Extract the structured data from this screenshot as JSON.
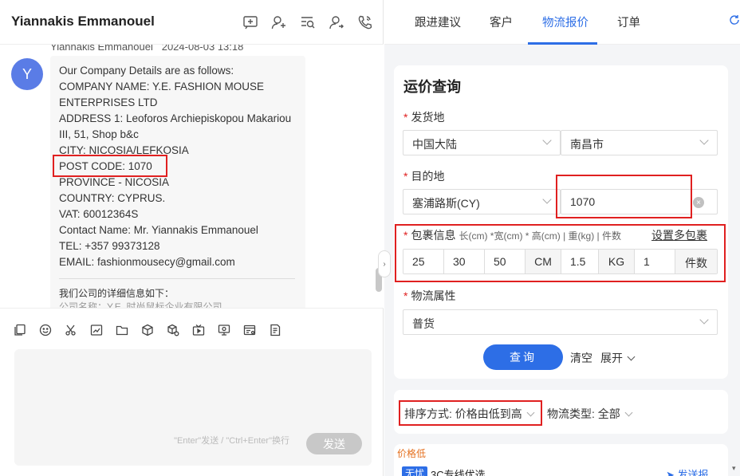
{
  "chat": {
    "contact_name": "Yiannakis Emmanouel",
    "meta_sender": "Yiannakis Emmanouel",
    "meta_time": "2024-08-03 13:18",
    "avatar_letter": "Y",
    "message_lines": [
      "Our Company Details are as follows:",
      "COMPANY NAME: Y.E. FASHION MOUSE",
      "ENTERPRISES LTD",
      "ADDRESS 1: Leoforos Archiepiskopou Makariou",
      "III, 51, Shop b&c",
      "CITY: NICOSIA/LEFKOSIA",
      "POST CODE: 1070",
      "PROVINCE - NICOSIA",
      "COUNTRY: CYPRUS.",
      "VAT: 60012364S",
      "Contact Name: Mr. Yiannakis Emmanouel",
      "TEL: +357 99373128",
      "EMAIL: fashionmousecy@gmail.com"
    ],
    "message_cn_line1": "我们公司的详细信息如下：",
    "message_cn_line2": "公司名称：Y.E. 时尚鼠标企业有限公司",
    "send_hint": "\"Enter\"发送 / \"Ctrl+Enter\"换行",
    "send_label": "发送"
  },
  "tabs": {
    "items": [
      "跟进建议",
      "客户",
      "物流报价",
      "订单"
    ],
    "active": "物流报价"
  },
  "form": {
    "title": "运价查询",
    "origin_label": "发货地",
    "origin_country": "中国大陆",
    "origin_city": "南昌市",
    "dest_label": "目的地",
    "dest_country": "塞浦路斯(CY)",
    "dest_postcode": "1070",
    "pkg_label": "包裹信息",
    "pkg_hint": "长(cm) *宽(cm) * 高(cm) | 重(kg) | 件数",
    "multi_pkg_link": "设置多包裹",
    "length": "25",
    "width": "30",
    "height": "50",
    "dim_unit": "CM",
    "weight": "1.5",
    "weight_unit": "KG",
    "count": "1",
    "count_unit": "件数",
    "attr_label": "物流属性",
    "attr_value": "普货",
    "query_label": "查询",
    "clear_label": "清空",
    "expand_label": "展开"
  },
  "sort": {
    "sort_label": "排序方式: 价格由低到高",
    "type_label": "物流类型: 全部"
  },
  "result": {
    "cheap_tag": "价格低",
    "badge": "无忧",
    "route_name": "3C专线优选",
    "send_quote": "发送报"
  },
  "colors": {
    "accent": "#2d6ee6",
    "highlight_red": "#e02020",
    "avatar": "#5a7ce6",
    "cheap_orange": "#e5701f"
  }
}
